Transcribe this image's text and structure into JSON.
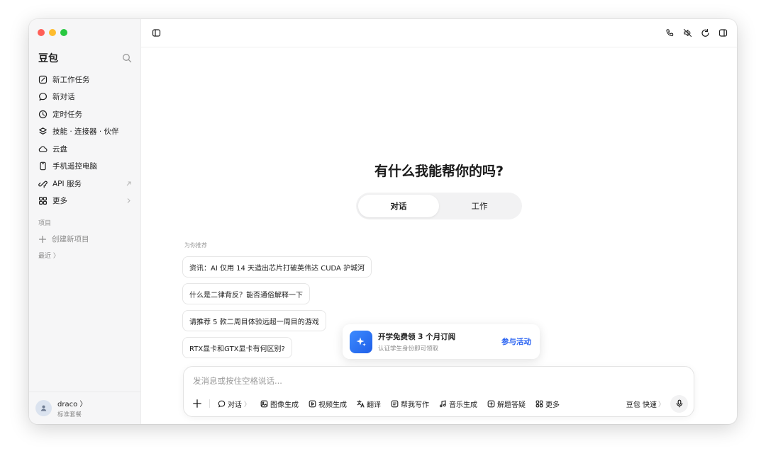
{
  "colors": {
    "traffic_red": "#ff5f57",
    "traffic_yellow": "#febc2e",
    "traffic_green": "#28c840",
    "accent": "#2a63f2"
  },
  "sidebar": {
    "brand": "豆包",
    "items": [
      {
        "label": "新工作任务",
        "icon": "edit-icon"
      },
      {
        "label": "新对话",
        "icon": "chat-bubble-icon"
      },
      {
        "label": "定时任务",
        "icon": "clock-icon"
      },
      {
        "label": "技能 · 连接器 · 伙伴",
        "icon": "layers-icon"
      },
      {
        "label": "云盘",
        "icon": "cloud-icon"
      },
      {
        "label": "手机遥控电脑",
        "icon": "phone-icon"
      },
      {
        "label": "API 服务",
        "icon": "api-icon"
      },
      {
        "label": "更多",
        "icon": "grid-icon"
      }
    ],
    "projects_label": "项目",
    "new_project": "创建新项目",
    "recent_label": "最近 〉",
    "user": {
      "name": "draco 〉",
      "plan": "标准套餐"
    }
  },
  "main": {
    "headline": "有什么我能帮你的吗?",
    "modes": [
      "对话",
      "工作"
    ],
    "recommend_label": "为你推荐",
    "recommendations": [
      "资讯：AI 仅用 14 天造出芯片打破英伟达 CUDA 护城河",
      "什么是二律背反？能否通俗解释一下",
      "请推荐 5 款二周目体验远超一周目的游戏",
      "RTX显卡和GTX显卡有何区别?"
    ],
    "promo": {
      "title": "开学免费领 3 个月订阅",
      "subtitle": "认证学生身份即可领取",
      "cta": "参与活动"
    },
    "composer": {
      "placeholder": "发消息或按住空格说话...",
      "tools": [
        {
          "label": "对话",
          "icon": "chat-bubble-icon",
          "chevron": "〉"
        },
        {
          "label": "图像生成",
          "icon": "image-icon"
        },
        {
          "label": "视频生成",
          "icon": "video-icon"
        },
        {
          "label": "翻译",
          "icon": "translate-icon"
        },
        {
          "label": "帮我写作",
          "icon": "write-icon"
        },
        {
          "label": "音乐生成",
          "icon": "music-icon"
        },
        {
          "label": "解题答疑",
          "icon": "solve-icon"
        },
        {
          "label": "更多",
          "icon": "grid-icon"
        }
      ],
      "model": "豆包 快速",
      "model_chevron": "〉"
    }
  }
}
